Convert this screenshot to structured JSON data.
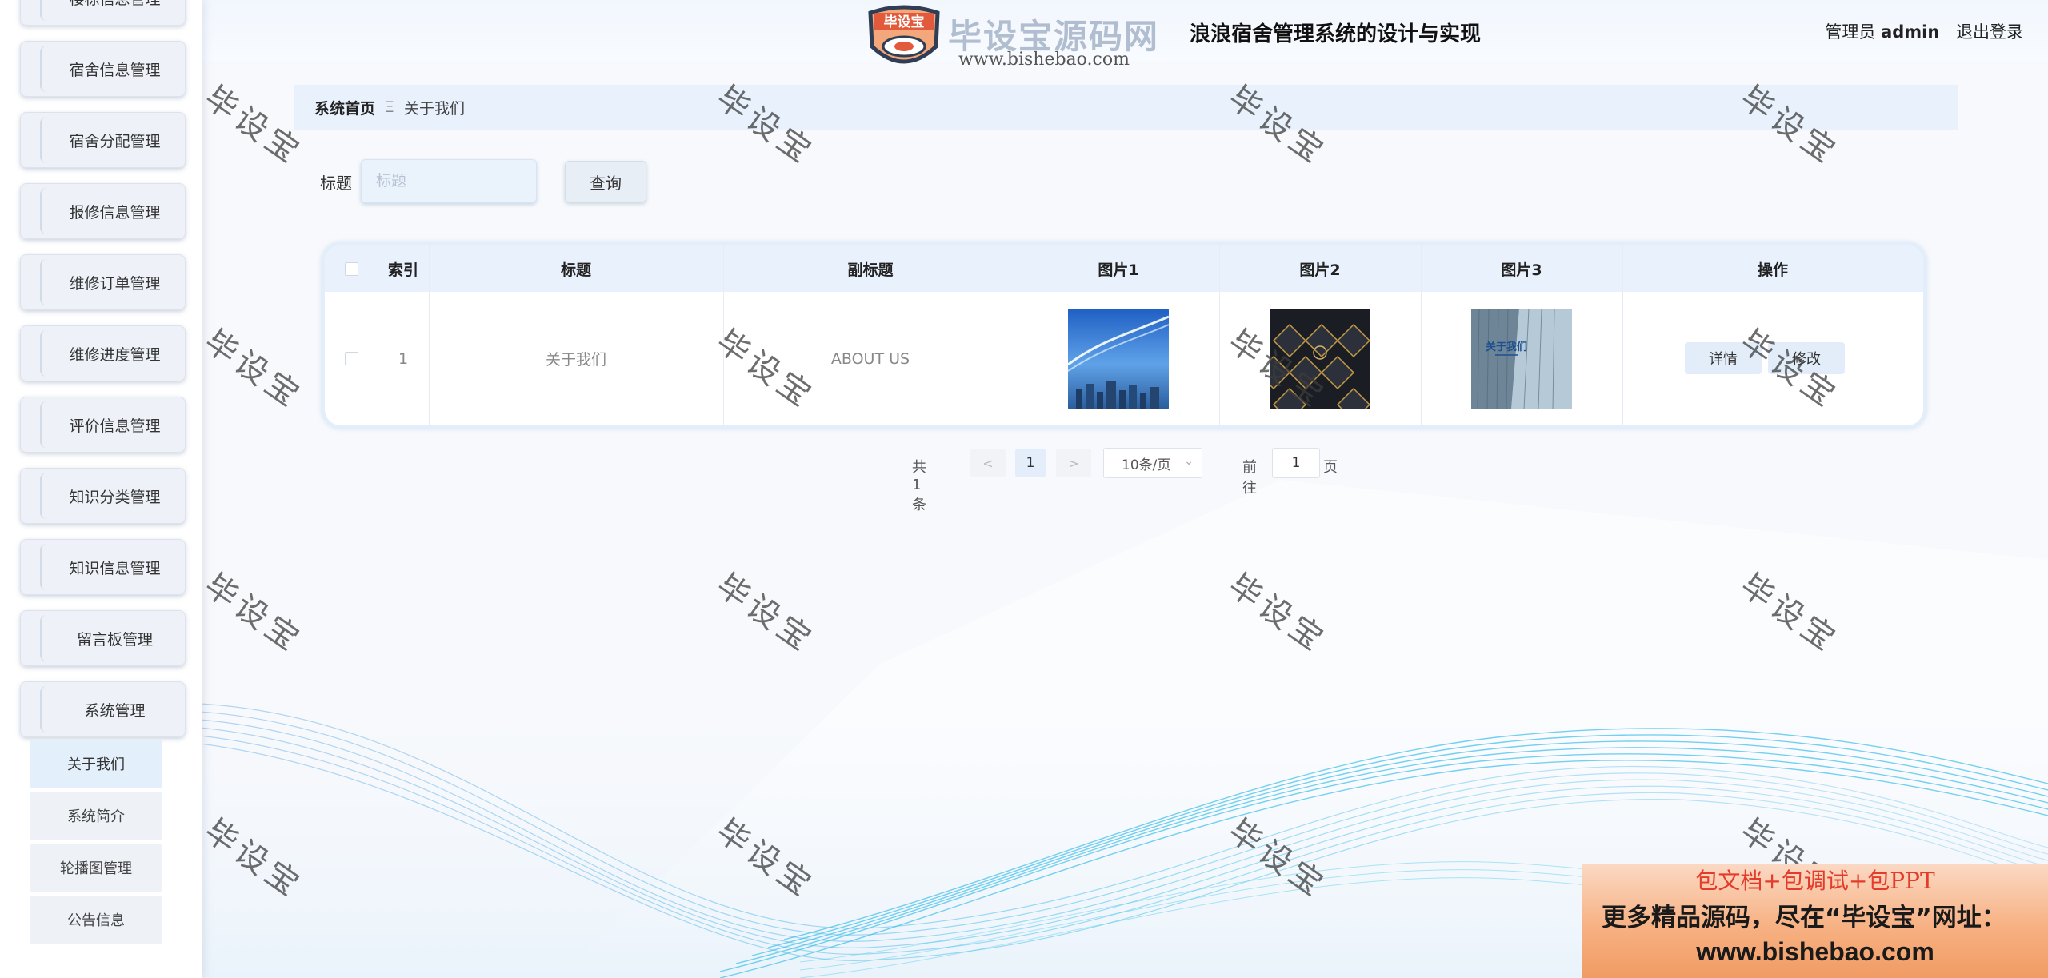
{
  "header": {
    "title": "浪浪宿舍管理系统的设计与实现",
    "user_role": "管理员",
    "username": "admin",
    "logout_label": "退出登录"
  },
  "logo": {
    "badge_text": "毕设宝",
    "site_name": "毕设宝源码网",
    "url": "www.bishebao.com"
  },
  "sidebar": {
    "items": [
      {
        "label": "楼栋信息管理"
      },
      {
        "label": "宿舍信息管理"
      },
      {
        "label": "宿舍分配管理"
      },
      {
        "label": "报修信息管理"
      },
      {
        "label": "维修订单管理"
      },
      {
        "label": "维修进度管理"
      },
      {
        "label": "评价信息管理"
      },
      {
        "label": "知识分类管理"
      },
      {
        "label": "知识信息管理"
      },
      {
        "label": "留言板管理"
      },
      {
        "label": "系统管理"
      }
    ],
    "sub_items": [
      {
        "label": "关于我们",
        "active": true
      },
      {
        "label": "系统简介"
      },
      {
        "label": "轮播图管理"
      },
      {
        "label": "公告信息"
      }
    ]
  },
  "breadcrumb": {
    "home": "系统首页",
    "separator": "Ξ",
    "current": "关于我们"
  },
  "search": {
    "label": "标题",
    "placeholder": "标题",
    "button_label": "查询"
  },
  "table": {
    "headers": {
      "index": "索引",
      "title": "标题",
      "subtitle": "副标题",
      "image1": "图片1",
      "image2": "图片2",
      "image3": "图片3",
      "actions": "操作"
    },
    "rows": [
      {
        "index": "1",
        "title": "关于我们",
        "subtitle": "ABOUT US",
        "image3_caption": "关于我们",
        "detail_label": "详情",
        "edit_label": "修改"
      }
    ]
  },
  "pagination": {
    "total": "共 1 条",
    "prev": "<",
    "current_page": "1",
    "next": ">",
    "page_size": "10条/页",
    "goto_label": "前往",
    "goto_value": "1",
    "page_label": "页"
  },
  "watermark": {
    "text": "毕设宝"
  },
  "ad": {
    "line1": "包文档+包调试+包PPT",
    "line2": "更多精品源码，尽在“毕设宝”网址：",
    "line3": "www.bishebao.com"
  },
  "colors": {
    "accent": "#e8f1fc",
    "ad_red": "#e33c2a",
    "ad_orange": "#f19b63"
  }
}
